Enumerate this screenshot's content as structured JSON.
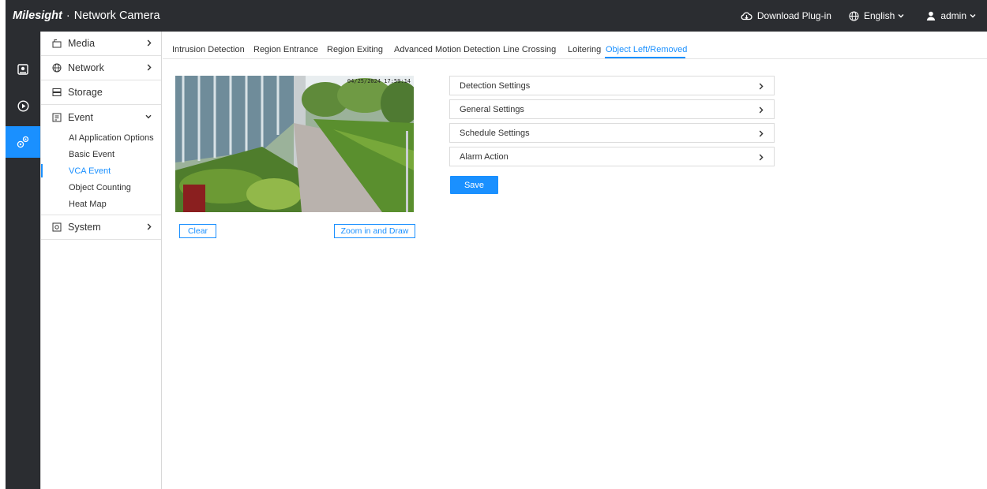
{
  "header": {
    "brand_logo": "Milesight",
    "brand_product": "Network Camera",
    "download": "Download Plug-in",
    "language": "English",
    "user": "admin"
  },
  "iconbar": {
    "items": [
      {
        "icon": "live-view-icon",
        "active": false
      },
      {
        "icon": "playback-icon",
        "active": false
      },
      {
        "icon": "settings-icon",
        "active": true
      }
    ]
  },
  "sidebar": {
    "media": "Media",
    "network": "Network",
    "storage": "Storage",
    "event": "Event",
    "event_children": [
      "AI Application Options",
      "Basic Event",
      "VCA Event",
      "Object Counting",
      "Heat Map"
    ],
    "system": "System"
  },
  "tabs": [
    "Intrusion Detection",
    "Region Entrance",
    "Region Exiting",
    "Advanced Motion Detection",
    "Line Crossing",
    "Loitering",
    "Object Left/Removed"
  ],
  "preview": {
    "timestamp": "04/25/2024 17:59:14"
  },
  "buttons": {
    "clear": "Clear",
    "zoom_draw": "Zoom in and Draw",
    "save": "Save"
  },
  "sections": [
    "Detection Settings",
    "General Settings",
    "Schedule Settings",
    "Alarm Action"
  ],
  "colors": {
    "accent": "#1a90ff",
    "topbar": "#2b2d31"
  }
}
